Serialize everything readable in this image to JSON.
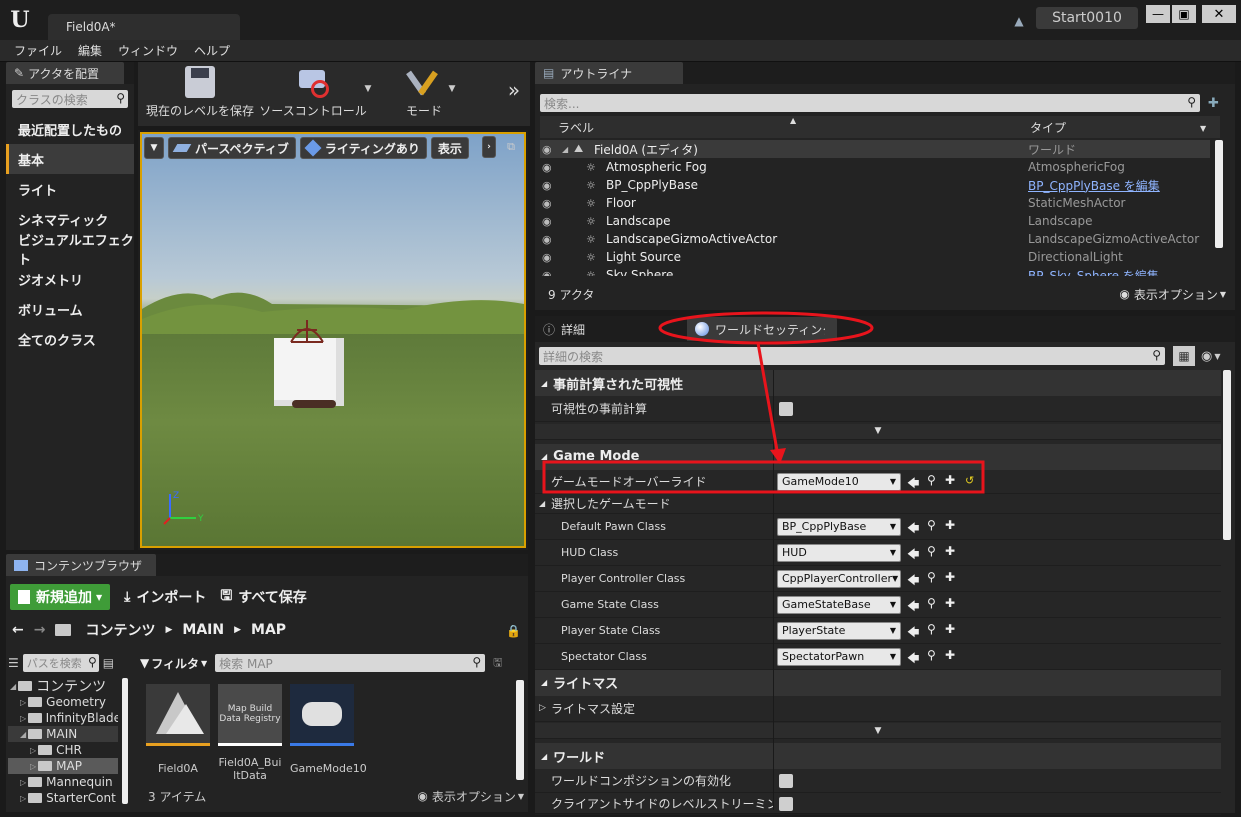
{
  "app": {
    "tab": "Field0A*",
    "project": "Start0010"
  },
  "menu": [
    "ファイル",
    "編集",
    "ウィンドウ",
    "ヘルプ"
  ],
  "place": {
    "tab": "アクタを配置",
    "search_placeholder": "クラスの検索",
    "categories": [
      "最近配置したもの",
      "基本",
      "ライト",
      "シネマティック",
      "ビジュアルエフェクト",
      "ジオメトリ",
      "ボリューム",
      "全てのクラス"
    ]
  },
  "toolbar": {
    "save": "現在のレベルを保存",
    "source": "ソースコントロール",
    "mode": "モード"
  },
  "viewport": {
    "view": "パースペクティブ",
    "lighting": "ライティングあり",
    "show": "表示"
  },
  "outliner": {
    "tab": "アウトライナ",
    "search_placeholder": "検索...",
    "col_label": "ラベル",
    "col_type": "タイプ",
    "rows": [
      {
        "label": "Field0A (エディタ)",
        "type": "ワールド",
        "link": false
      },
      {
        "label": "Atmospheric Fog",
        "type": "AtmosphericFog",
        "link": false
      },
      {
        "label": "BP_CppPlyBase",
        "type": "BP_CppPlyBase を編集",
        "link": true
      },
      {
        "label": "Floor",
        "type": "StaticMeshActor",
        "link": false
      },
      {
        "label": "Landscape",
        "type": "Landscape",
        "link": false
      },
      {
        "label": "LandscapeGizmoActiveActor",
        "type": "LandscapeGizmoActiveActor",
        "link": false
      },
      {
        "label": "Light Source",
        "type": "DirectionalLight",
        "link": false
      },
      {
        "label": "Sky Sphere",
        "type": "BP_Sky_Sphere を編集",
        "link": true
      }
    ],
    "count": "9 アクタ",
    "view_options": "表示オプション"
  },
  "details": {
    "tab_details": "詳細",
    "tab_world": "ワールドセッティンク",
    "search_placeholder": "詳細の検索",
    "sec_precomp": "事前計算された可視性",
    "precomp_row": "可視性の事前計算",
    "sec_gamemode": "Game Mode",
    "override_label": "ゲームモードオーバーライド",
    "override_value": "GameMode10",
    "selected_gm": "選択したゲームモード",
    "gm_rows": [
      {
        "label": "Default Pawn Class",
        "value": "BP_CppPlyBase"
      },
      {
        "label": "HUD Class",
        "value": "HUD"
      },
      {
        "label": "Player Controller Class",
        "value": "CppPlayerController"
      },
      {
        "label": "Game State Class",
        "value": "GameStateBase"
      },
      {
        "label": "Player State Class",
        "value": "PlayerState"
      },
      {
        "label": "Spectator Class",
        "value": "SpectatorPawn"
      }
    ],
    "sec_lightmass": "ライトマス",
    "lightmass_row": "ライトマス設定",
    "sec_world": "ワールド",
    "world_row1": "ワールドコンポジションの有効化",
    "world_row2": "クライアントサイドのレベルストリーミングボリュ"
  },
  "content": {
    "tab": "コンテンツブラウザ",
    "add_new": "新規追加",
    "import": "インポート",
    "save_all": "すべて保存",
    "path": [
      "コンテンツ",
      "MAIN",
      "MAP"
    ],
    "path_search": "パスを検索",
    "filter": "フィルタ",
    "search_placeholder": "検索 MAP",
    "tree": [
      {
        "label": "コンテンツ",
        "indent": 0
      },
      {
        "label": "Geometry",
        "indent": 1
      },
      {
        "label": "InfinityBlade",
        "indent": 1
      },
      {
        "label": "MAIN",
        "indent": 1
      },
      {
        "label": "CHR",
        "indent": 2
      },
      {
        "label": "MAP",
        "indent": 2
      },
      {
        "label": "Mannequin",
        "indent": 1
      },
      {
        "label": "StarterCont",
        "indent": 1
      }
    ],
    "assets": [
      {
        "name": "Field0A",
        "thumb": ""
      },
      {
        "name": "Field0A_BuiltData",
        "thumb": "Map Build Data Registry"
      },
      {
        "name": "GameMode10",
        "thumb": ""
      }
    ],
    "count": "3 アイテム",
    "view_options": "表示オプション"
  },
  "colors": {
    "accent": "#e8a020",
    "annotation": "#e8141c",
    "link": "#8fb4ff",
    "add_button": "#3f9c38"
  }
}
